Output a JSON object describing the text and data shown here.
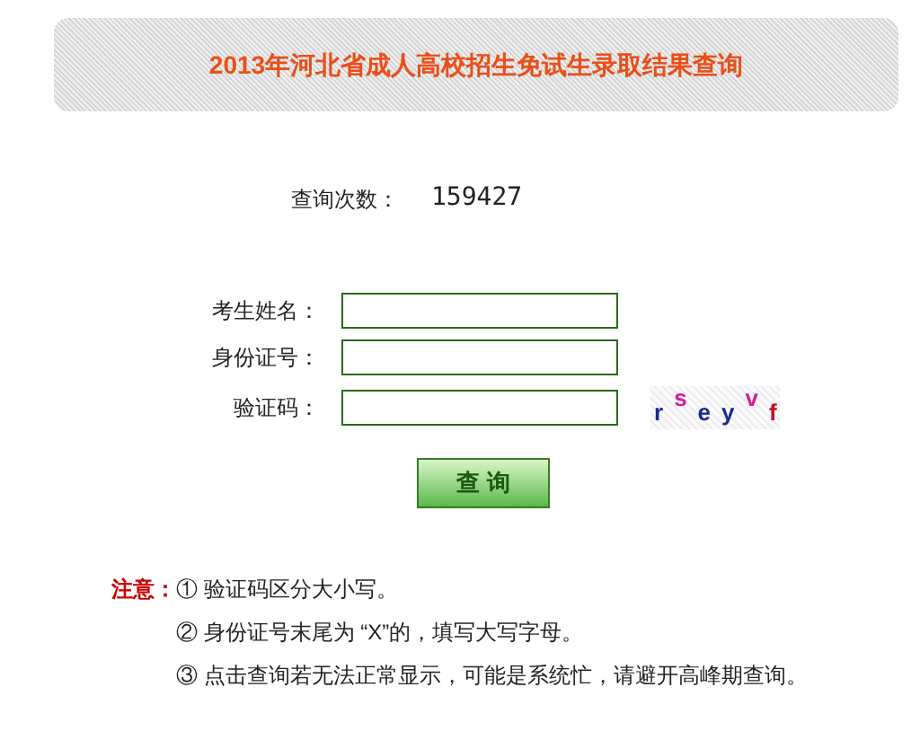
{
  "header": {
    "title": "2013年河北省成人高校招生免试生录取结果查询"
  },
  "query_count": {
    "label": "查询次数：",
    "value": "159427"
  },
  "form": {
    "fields": [
      {
        "label": "考生姓名："
      },
      {
        "label": "身份证号："
      },
      {
        "label": "验证码："
      }
    ],
    "captcha": [
      {
        "char": "r",
        "color": "#1a2a8a"
      },
      {
        "char": "s",
        "color": "#d0209a"
      },
      {
        "char": "e",
        "color": "#1a2a8a"
      },
      {
        "char": "y",
        "color": "#1a2a8a"
      },
      {
        "char": "v",
        "color": "#d0209a"
      },
      {
        "char": "f",
        "color": "#c0102a"
      }
    ],
    "submit": "查 询"
  },
  "notes": {
    "label": "注意：",
    "items": [
      "① 验证码区分大小写。",
      "② 身份证号末尾为 “X”的，填写大写字母。",
      "③ 点击查询若无法正常显示，可能是系统忙，请避开高峰期查询。"
    ]
  }
}
